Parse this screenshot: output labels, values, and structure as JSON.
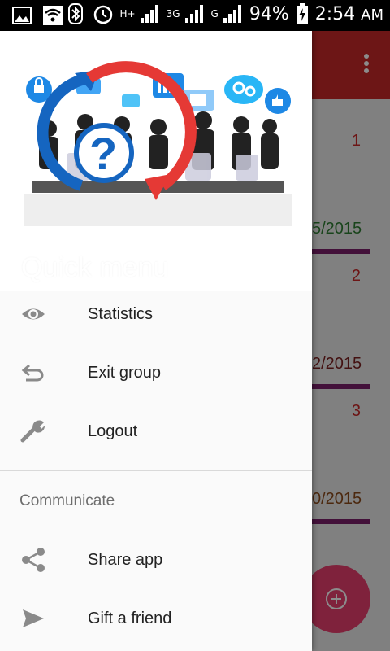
{
  "status_bar": {
    "network_labels": [
      "H+",
      "3G",
      "G"
    ],
    "battery": "94%",
    "time": "2:54",
    "ampm": "AM"
  },
  "background": {
    "toolbar_color": "#c62828",
    "cards": [
      {
        "number": "1",
        "date": "5/2015",
        "date_color": "#2e7d32"
      },
      {
        "number": "2",
        "date": "2/2015",
        "date_color": "#7b1f1f"
      },
      {
        "number": "3",
        "date": "0/2015",
        "date_color": "#8a4a1a"
      }
    ]
  },
  "drawer": {
    "header_title": "Quick menu",
    "items": [
      {
        "label": "Statistics",
        "icon": "eye-icon"
      },
      {
        "label": "Exit group",
        "icon": "undo-icon"
      },
      {
        "label": "Logout",
        "icon": "wrench-icon"
      }
    ],
    "section_label": "Communicate",
    "communicate_items": [
      {
        "label": "Share app",
        "icon": "share-icon"
      },
      {
        "label": "Gift a friend",
        "icon": "send-icon"
      }
    ]
  }
}
